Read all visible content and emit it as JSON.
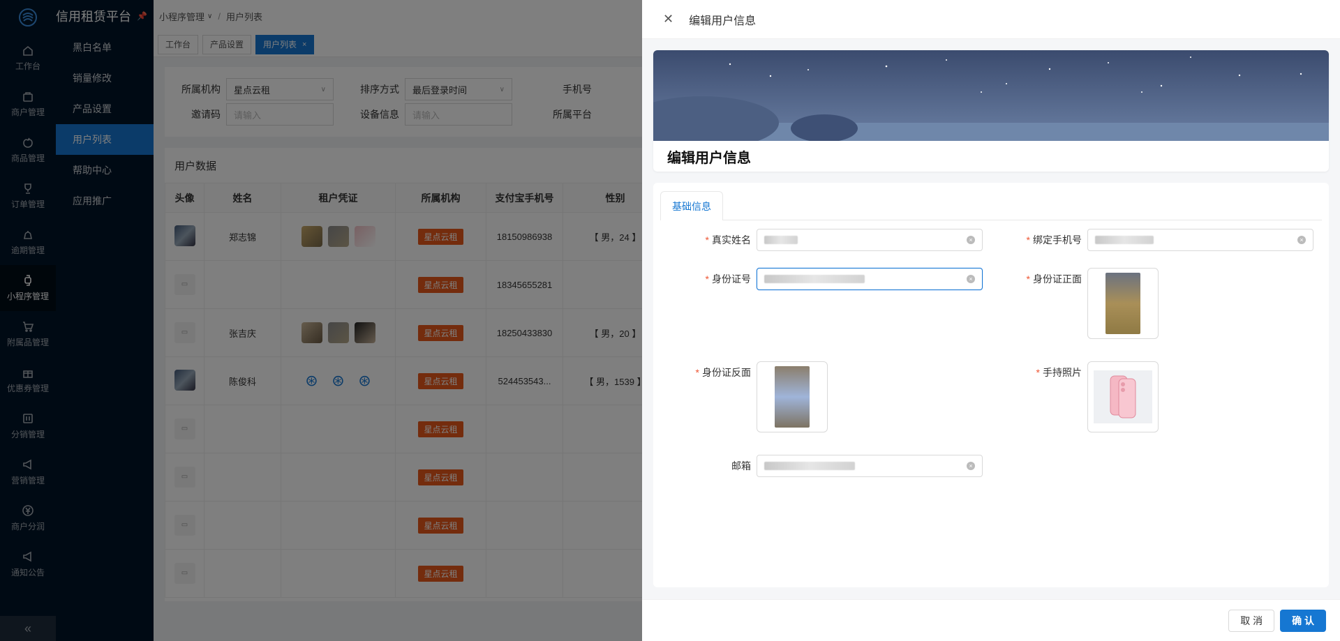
{
  "app": {
    "title": "信用租赁平台"
  },
  "rail": {
    "items": [
      {
        "label": "工作台",
        "icon": "home-icon"
      },
      {
        "label": "商户管理",
        "icon": "bag-icon"
      },
      {
        "label": "商品管理",
        "icon": "apple-icon"
      },
      {
        "label": "订单管理",
        "icon": "trophy-icon"
      },
      {
        "label": "逾期管理",
        "icon": "alarm-icon"
      },
      {
        "label": "小程序管理",
        "icon": "watch-icon"
      },
      {
        "label": "附属品管理",
        "icon": "cart-icon"
      },
      {
        "label": "优惠券管理",
        "icon": "gift-icon"
      },
      {
        "label": "分销管理",
        "icon": "split-icon"
      },
      {
        "label": "营销管理",
        "icon": "megaphone-icon"
      },
      {
        "label": "商户分润",
        "icon": "yen-icon"
      },
      {
        "label": "通知公告",
        "icon": "notice-icon"
      }
    ],
    "collapse": "«"
  },
  "sub_menu": {
    "items": [
      "黑白名单",
      "销量修改",
      "产品设置",
      "用户列表",
      "帮助中心",
      "应用推广"
    ],
    "active_index": 3
  },
  "breadcrumb": {
    "parent": "小程序管理",
    "sep": "/",
    "current": "用户列表"
  },
  "tabs": [
    {
      "label": "工作台"
    },
    {
      "label": "产品设置"
    },
    {
      "label": "用户列表",
      "close": "×"
    }
  ],
  "filters": {
    "org_label": "所属机构",
    "org_value": "星点云租",
    "sort_label": "排序方式",
    "sort_value": "最后登录时间",
    "phone_label": "手机号",
    "invite_label": "邀请码",
    "invite_placeholder": "请输入",
    "device_label": "设备信息",
    "device_placeholder": "请输入",
    "platform_label": "所属平台"
  },
  "table": {
    "title": "用户数据",
    "headers": [
      "头像",
      "姓名",
      "租户凭证",
      "所属机构",
      "支付宝手机号",
      "性别"
    ],
    "rows": [
      {
        "name": "郑志锦",
        "org": "星点云租",
        "phone": "18150986938",
        "gender": "【 男，24 】"
      },
      {
        "name": "",
        "org": "星点云租",
        "phone": "18345655281",
        "gender": ""
      },
      {
        "name": "张吉庆",
        "org": "星点云租",
        "phone": "18250433830",
        "gender": "【 男，20 】"
      },
      {
        "name": "陈俊科",
        "org": "星点云租",
        "phone": "524453543...",
        "gender": "【 男，1539 】"
      },
      {
        "name": "",
        "org": "星点云租",
        "phone": "",
        "gender": ""
      },
      {
        "name": "",
        "org": "星点云租",
        "phone": "",
        "gender": ""
      },
      {
        "name": "",
        "org": "星点云租",
        "phone": "",
        "gender": ""
      },
      {
        "name": "",
        "org": "星点云租",
        "phone": "",
        "gender": ""
      }
    ]
  },
  "drawer": {
    "title": "编辑用户信息",
    "banner_title": "编辑用户信息",
    "tab": "基础信息",
    "fields": {
      "real_name": "真实姓名",
      "bind_phone": "绑定手机号",
      "id_number": "身份证号",
      "id_front": "身份证正面",
      "id_back": "身份证反面",
      "hand_photo": "手持照片",
      "email": "邮箱"
    },
    "required_mark": "*",
    "cancel": "取 消",
    "confirm": "确 认"
  }
}
